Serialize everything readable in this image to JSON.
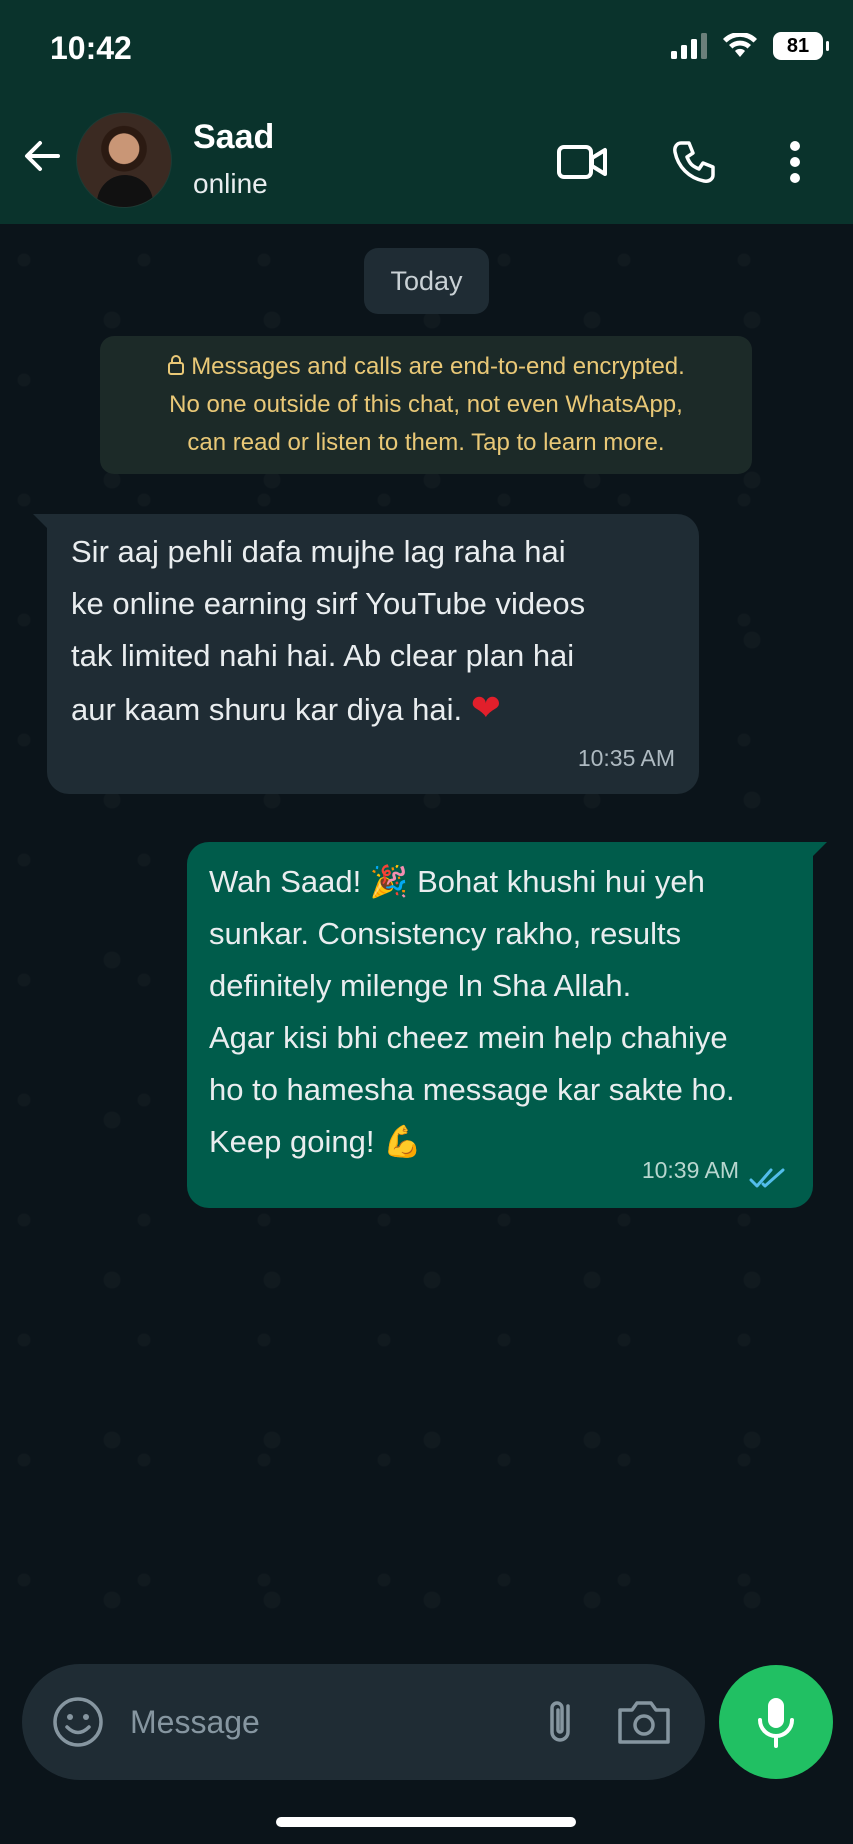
{
  "status_bar": {
    "time": "10:42",
    "battery": "81"
  },
  "header": {
    "name": "Saad",
    "status": "online"
  },
  "date_chip": "Today",
  "encryption_notice": {
    "lines": [
      "Messages and calls are end-to-end encrypted.",
      "No one outside of this chat, not even WhatsApp,",
      "can read or listen to them. Tap to learn more."
    ]
  },
  "messages": [
    {
      "direction": "incoming",
      "lines": [
        "Sir aaj pehli dafa mujhe lag raha hai",
        "ke online earning sirf YouTube videos",
        "tak limited nahi hai. Ab clear plan hai",
        "aur kaam shuru kar diya hai."
      ],
      "emoji": "❤",
      "time": "10:35 AM"
    },
    {
      "direction": "outgoing",
      "lines": [
        "Wah Saad!",
        "Bohat khushi hui yeh",
        "sunkar. Consistency rakho, results",
        "definitely milenge In Sha Allah.",
        "Agar kisi bhi cheez mein help chahiye",
        "ho to hamesha message kar sakte ho.",
        "Keep going!"
      ],
      "emojis": [
        "🎉",
        "💪"
      ],
      "time": "10:39 AM",
      "read_receipt_color": "#53bdeb"
    }
  ],
  "composer": {
    "placeholder": "Message"
  },
  "colors": {
    "header_bg": "#0a332c",
    "chat_bg": "#0b141a",
    "incoming_bubble": "#1f2c34",
    "outgoing_bubble": "#005c4b",
    "mic_button": "#21c063",
    "encryption_text": "#e9c877"
  },
  "icons": [
    "signal-icon",
    "wifi-icon",
    "battery-icon",
    "back-arrow-icon",
    "video-call-icon",
    "phone-icon",
    "more-vertical-icon",
    "lock-icon",
    "double-check-icon",
    "emoji-icon",
    "paperclip-icon",
    "camera-icon",
    "mic-icon"
  ]
}
